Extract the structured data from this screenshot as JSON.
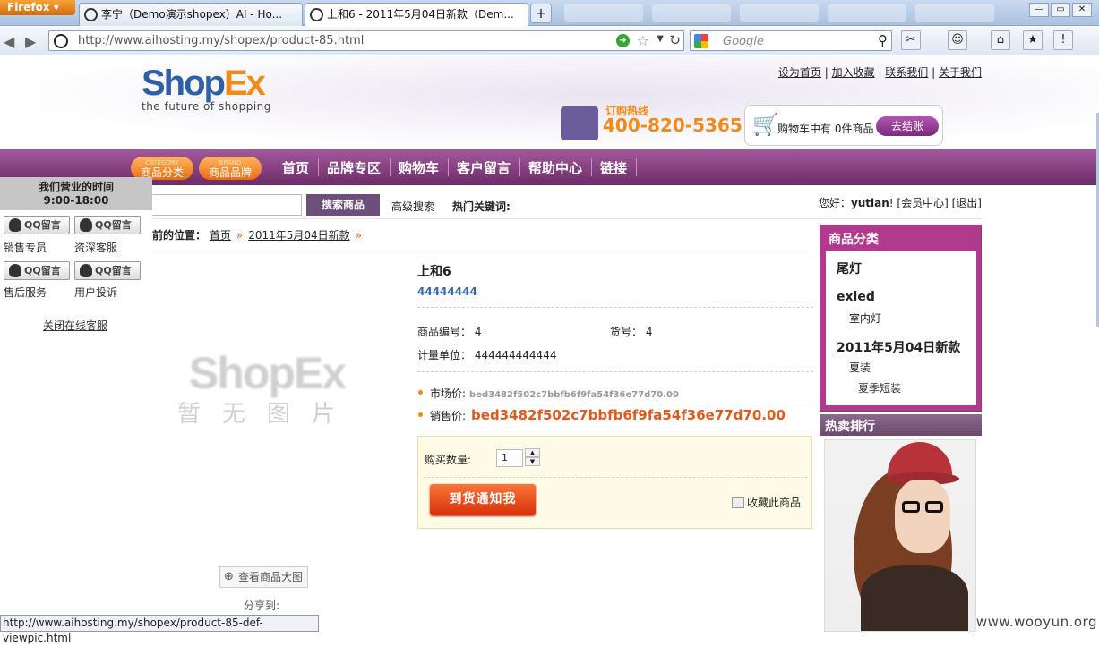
{
  "browser": {
    "app_button": "Firefox",
    "tabs": [
      {
        "title": "李宁（Demo演示shopex）AI - Ho..."
      },
      {
        "title": "上和6 - 2011年5月04日新款（Dem..."
      }
    ],
    "new_tab": "+",
    "url": "http://www.aihosting.my/shopex/product-85.html",
    "search_placeholder": "Google",
    "status_url": "http://www.aihosting.my/shopex/product-85-def-viewpic.html"
  },
  "header": {
    "logo_text_a": "Shop",
    "logo_text_b": "Ex",
    "logo_tagline": "the future of shopping",
    "top_links": [
      "设为首页",
      "加入收藏",
      "联系我们",
      "关于我们"
    ],
    "hotline_label": "订购热线",
    "hotline_number": "400-820-5365",
    "cart_text": "购物车中有 0件商品",
    "checkout_button": "去结账"
  },
  "nav": {
    "category_small": "CATEGORY",
    "category_label": "商品分类",
    "brand_small": "BRAND",
    "brand_label": "商品品牌",
    "items": [
      "首页",
      "品牌专区",
      "购物车",
      "客户留言",
      "帮助中心",
      "链接"
    ]
  },
  "searchbar": {
    "button": "搜索商品",
    "advanced": "高级搜索",
    "hot_keywords": "热门关键词:",
    "greeting": "您好：",
    "username": "yutian",
    "member_center": "[会员中心]",
    "logout": "[退出]"
  },
  "service": {
    "title": "我们营业的时间",
    "hours": "9:00-18:00",
    "qq_label": "QQ留言",
    "agents": [
      "销售专员",
      "资深客服",
      "售后服务",
      "用户投诉"
    ],
    "close": "关闭在线客服"
  },
  "breadcrumb": {
    "prefix": "您当前的位置：",
    "items": [
      "首页",
      "2011年5月04日新款"
    ]
  },
  "product": {
    "no_image_logo": "ShopEx",
    "no_image_text": "暂无图片",
    "view_large": "查看商品大图",
    "share": "分享到:",
    "name": "上和6",
    "subtitle": "44444444",
    "code_label": "商品编号：",
    "code_value": "4",
    "sku_label": "货号：",
    "sku_value": "4",
    "unit_label": "计量单位：",
    "unit_value": "444444444444",
    "market_price_label": "市场价:",
    "market_price": "bed3482f502c7bbfb6f9fa54f36e77d70.00",
    "sale_price_label": "销售价:",
    "sale_price": "bed3482f502c7bbfb6f9fa54f36e77d70.00",
    "qty_label": "购买数量:",
    "qty_value": "1",
    "notify_button": "到货通知我",
    "favorite": "收藏此商品"
  },
  "sidebar": {
    "category_title": "商品分类",
    "categories": [
      {
        "name": "尾灯"
      },
      {
        "name": "exled",
        "children": [
          "室内灯"
        ]
      },
      {
        "name": "2011年5月04日新款",
        "children": [
          "夏装"
        ],
        "grandchildren": [
          "夏季短装"
        ]
      }
    ],
    "hot_title": "热卖排行"
  },
  "watermark": "www.wooyun.org"
}
